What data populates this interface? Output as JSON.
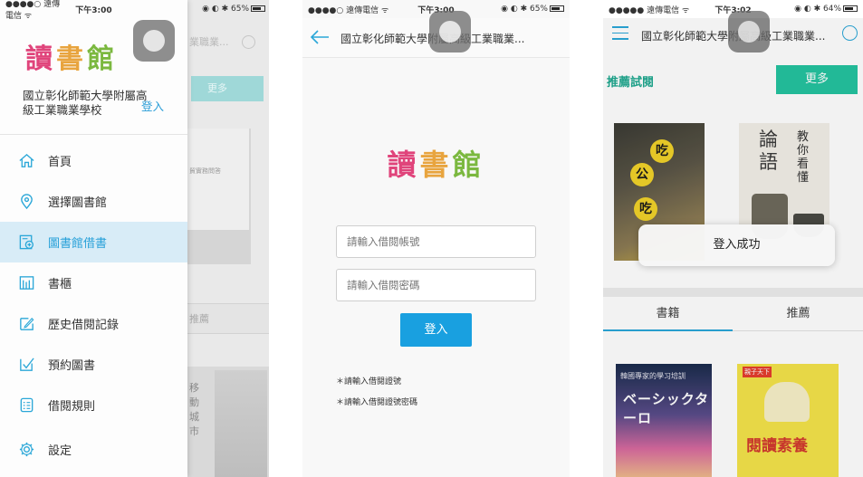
{
  "panel1": {
    "status": {
      "carrier": "●●●●○ 遠傳電信 ᯤ",
      "time": "下午3:00",
      "right": "◉ ◐ ✱ 65%",
      "battery_level": 0.65
    },
    "logo": [
      "讀",
      "書",
      "館"
    ],
    "school_name": "國立彰化師範大學附屬高級工業職業學校",
    "login_link": "登入",
    "menu": [
      {
        "label": "首頁",
        "icon": "home-icon"
      },
      {
        "label": "選擇圖書館",
        "icon": "location-pin-icon"
      },
      {
        "label": "圖書館借書",
        "icon": "borrow-book-icon",
        "active": true
      },
      {
        "label": "書櫃",
        "icon": "bookshelf-icon"
      },
      {
        "label": "歷史借閱記錄",
        "icon": "history-edit-icon"
      },
      {
        "label": "預約圖書",
        "icon": "reserve-check-icon"
      },
      {
        "label": "借閱規則",
        "icon": "rules-list-icon"
      },
      {
        "label": "設定",
        "icon": "settings-gear-icon"
      }
    ],
    "background": {
      "search_text": "業職業...",
      "more_label": "更多",
      "tab_label": "推薦",
      "book1_caption": "貿實務問答",
      "book2_title": [
        "移",
        "動",
        "城",
        "市"
      ]
    }
  },
  "panel2": {
    "status": {
      "carrier": "●●●●○ 遠傳電信 ᯤ",
      "time": "下午3:00",
      "right": "◉ ◐ ✱ 65%",
      "battery_level": 0.65
    },
    "nav_title": "國立彰化師範大學附屬高級工業職業...",
    "logo": [
      "讀",
      "書",
      "館"
    ],
    "account_placeholder": "請輸入借閱帳號",
    "password_placeholder": "請輸入借閱密碼",
    "login_button": "登入",
    "notes": [
      "＊請輸入借閱證號",
      "＊請輸入借閱證號密碼"
    ]
  },
  "panel3": {
    "status": {
      "carrier": "●●●●● 遠傳電信 ᯤ",
      "time": "下午3:02",
      "right": "◉ ◐ ✱ 64%",
      "battery_level": 0.64
    },
    "nav_title": "國立彰化師範大學附屬高級工業職業...",
    "section_label": "推薦試閱",
    "more_button": "更多",
    "cover_a_chars": [
      "吃",
      "公",
      "吃"
    ],
    "cover_b": {
      "title_chars": [
        "論",
        "語"
      ],
      "side_chars": [
        "教",
        "你",
        "看",
        "懂"
      ]
    },
    "tabs": [
      {
        "label": "書籍",
        "active": true
      },
      {
        "label": "推薦",
        "active": false
      }
    ],
    "cover_c": {
      "small": "韓國專家的學习培訓",
      "title": "ベーシックターロ"
    },
    "cover_d": {
      "tag": "親子天下",
      "title": "閱讀素養"
    },
    "toast": "登入成功"
  }
}
